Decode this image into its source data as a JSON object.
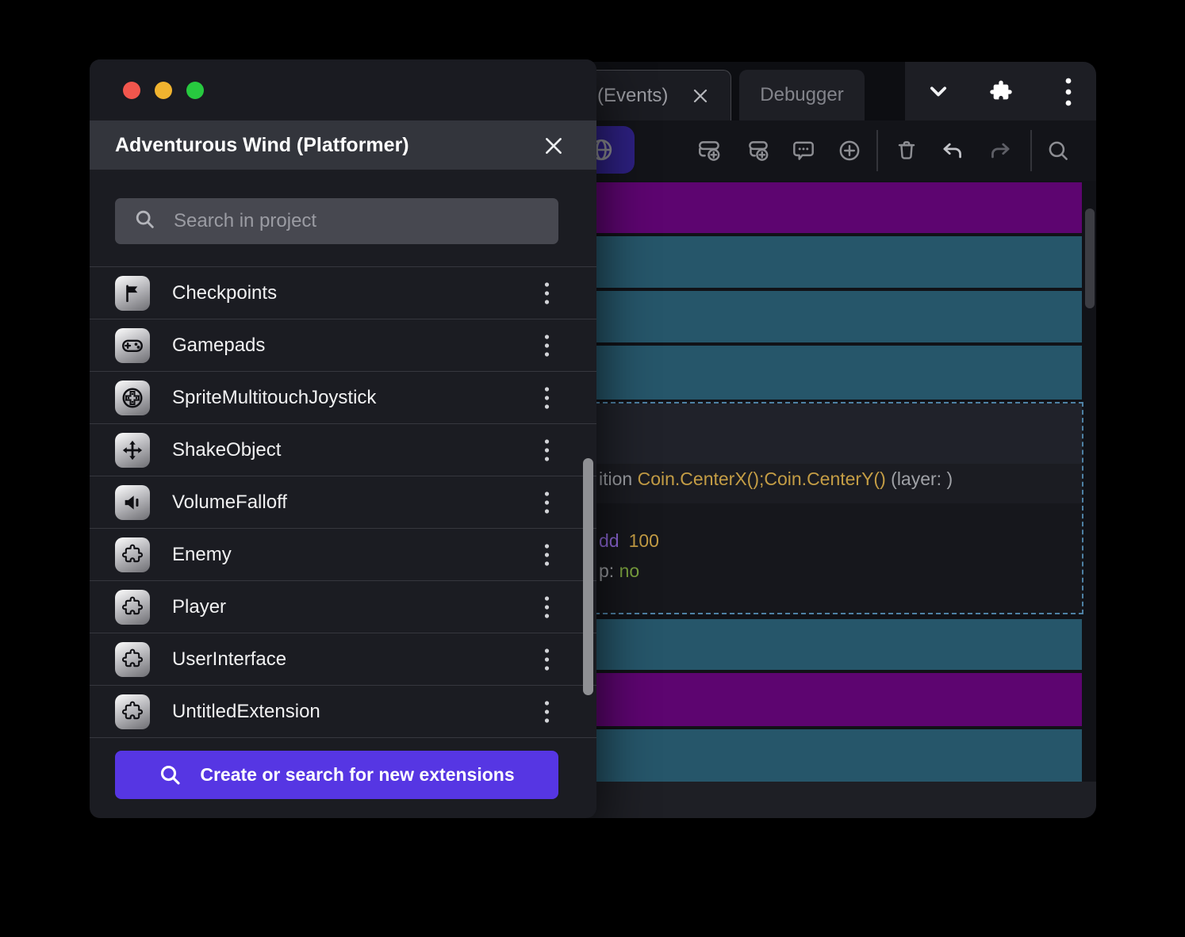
{
  "dialog": {
    "title": "Adventurous Wind (Platformer)",
    "search_placeholder": "Search in project",
    "extensions": [
      {
        "name": "Checkpoints",
        "icon": "flag-icon"
      },
      {
        "name": "Gamepads",
        "icon": "gamepad-icon"
      },
      {
        "name": "SpriteMultitouchJoystick",
        "icon": "joystick-icon"
      },
      {
        "name": "ShakeObject",
        "icon": "move-arrows-icon"
      },
      {
        "name": "VolumeFalloff",
        "icon": "speaker-icon"
      },
      {
        "name": "Enemy",
        "icon": "puzzle-icon"
      },
      {
        "name": "Player",
        "icon": "puzzle-icon"
      },
      {
        "name": "UserInterface",
        "icon": "puzzle-icon"
      },
      {
        "name": "UntitledExtension",
        "icon": "puzzle-icon"
      }
    ],
    "create_button_label": "Create or search for new extensions",
    "accent_color": "#5636e3"
  },
  "editor": {
    "tabs": [
      {
        "label": "(Events)",
        "active": true,
        "closable": true
      },
      {
        "label": "Debugger",
        "active": false,
        "closable": false
      }
    ],
    "selected_event": {
      "action_line": {
        "prefix": "ition ",
        "expression": "Coin.CenterX();Coin.CenterY()",
        "suffix": " (layer: )"
      },
      "value_line": {
        "keyword": "dd",
        "value": "100"
      },
      "flag_line": {
        "prefix": "p: ",
        "value": "no"
      }
    },
    "event_rows": [
      {
        "color": "purple"
      },
      {
        "color": "teal"
      },
      {
        "color": "teal"
      },
      {
        "color": "teal"
      },
      {
        "color": "teal"
      },
      {
        "color": "purple"
      },
      {
        "color": "teal"
      }
    ],
    "colors": {
      "teal": "#26566a",
      "purple": "#5d0570",
      "selection_border": "#4e81a4"
    }
  }
}
